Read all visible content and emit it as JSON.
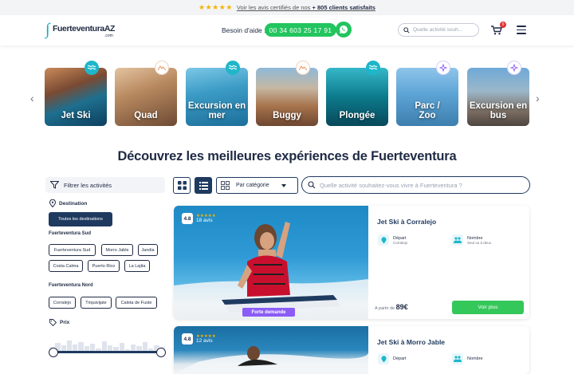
{
  "topbar": {
    "stars": "★★★★★",
    "review_prefix": "Voir les avis certifiés de nos ",
    "review_count": "+ 805 clients satisfaits"
  },
  "header": {
    "logo_main": "FuerteventuraAZ",
    "logo_sub": ".com",
    "help_label": "Besoin d'aide :",
    "phone": "00 34 603 25 17 91",
    "search_placeholder": "Quelle activité souh...",
    "cart_count": "0"
  },
  "categories": [
    {
      "label": "Jet Ski",
      "badge_color": "#1fb6c9",
      "icon": "water-waves-icon"
    },
    {
      "label": "Quad",
      "badge_color": "#ffffff",
      "icon": "mountain-icon"
    },
    {
      "label": "Excursion en mer",
      "badge_color": "#1fb6c9",
      "icon": "water-waves-icon"
    },
    {
      "label": "Buggy",
      "badge_color": "#ffffff",
      "icon": "mountain-icon"
    },
    {
      "label": "Plongée",
      "badge_color": "#1fb6c9",
      "icon": "water-waves-icon"
    },
    {
      "label": "Parc / Zoo",
      "badge_color": "#ffffff",
      "icon": "sparkle-icon"
    },
    {
      "label": "Excursion en bus",
      "badge_color": "#ffffff",
      "icon": "sparkle-icon"
    }
  ],
  "page_title": "Découvrez les meilleures expériences de Fuerteventura",
  "filters": {
    "title": "Filtrer les activités",
    "destination_label": "Destination",
    "all_destinations": "Toutes les destinations",
    "south_label": "Fuerteventura Sud",
    "south": [
      "Fuerteventura Sud",
      "Morro Jable",
      "Jandia",
      "Costa Calma",
      "Puerto Rico",
      "La Lajita"
    ],
    "north_label": "Fuerteventura Nord",
    "north": [
      "Corralejo",
      "Triquivijate",
      "Caleta de Fuste"
    ],
    "price_label": "Prix"
  },
  "toolbar": {
    "sort_label": "Par catégorie",
    "search_placeholder": "Quelle activité souhaitez-vous vivre à Fuerteventura ?"
  },
  "cards": [
    {
      "rating": "4.8",
      "stars": "★★★★★",
      "reviews": "18 avis",
      "badge": "Forte demande",
      "title": "Jet Ski à Corralejo",
      "depart_label": "Départ",
      "depart_value": "Corralejo",
      "number_label": "Nombre",
      "number_value": "Seul ou à deux",
      "price_prefix": "A partir de",
      "price": "89€",
      "cta": "Voir plus"
    },
    {
      "rating": "4.8",
      "stars": "★★★★★",
      "reviews": "12 avis",
      "title": "Jet Ski à Morro Jable",
      "depart_label": "Départ",
      "number_label": "Nombre"
    }
  ],
  "colors": {
    "navy": "#1f3a5f",
    "green": "#22c55e",
    "teal": "#1fb6c9",
    "star": "#f5b400",
    "purple": "#8b5cf6"
  }
}
